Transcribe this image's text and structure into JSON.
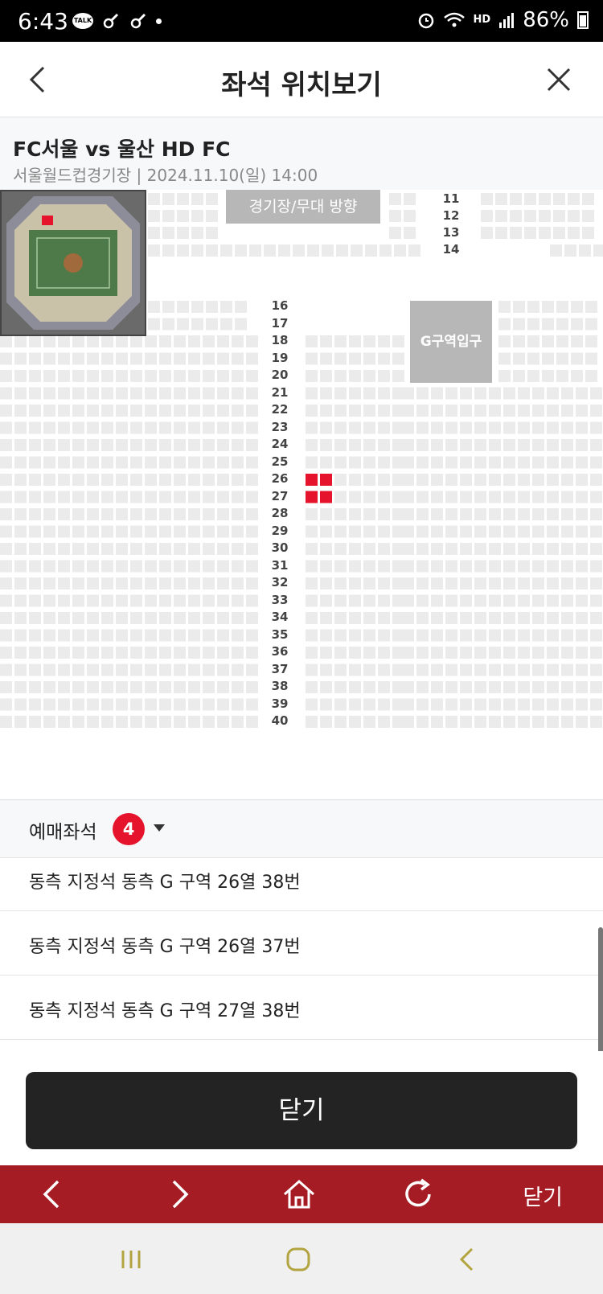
{
  "status_bar": {
    "time": "6:43",
    "talk_badge": "TALK",
    "hd_label": "HD",
    "battery_percent": "86%"
  },
  "header": {
    "title": "좌석 위치보기"
  },
  "match": {
    "title": "FC서울 vs 울산 HD FC",
    "venue_datetime": "서울월드컵경기장 | 2024.11.10(일) 14:00"
  },
  "seat_map": {
    "stage_label": "경기장/무대 방향",
    "entrance_label": "G구역입구",
    "top_rows": [
      "11",
      "12",
      "13",
      "14"
    ],
    "rows": [
      "16",
      "17",
      "18",
      "19",
      "20",
      "21",
      "22",
      "23",
      "24",
      "25",
      "26",
      "27",
      "28",
      "29",
      "30",
      "31",
      "32",
      "33",
      "34",
      "35",
      "36",
      "37",
      "38",
      "39",
      "40"
    ],
    "selected_color": "#e5142c",
    "seat_color": "#ebebeb"
  },
  "booking": {
    "label": "예매좌석",
    "count": "4",
    "seats": [
      "동측 지정석 동측 G 구역 26열 38번",
      "동측 지정석 동측 G 구역 26열 37번",
      "동측 지정석 동측 G 구역 27열 38번"
    ],
    "close_button": "닫기"
  },
  "browser_bar": {
    "close_label": "닫기",
    "color": "#a51c24"
  }
}
